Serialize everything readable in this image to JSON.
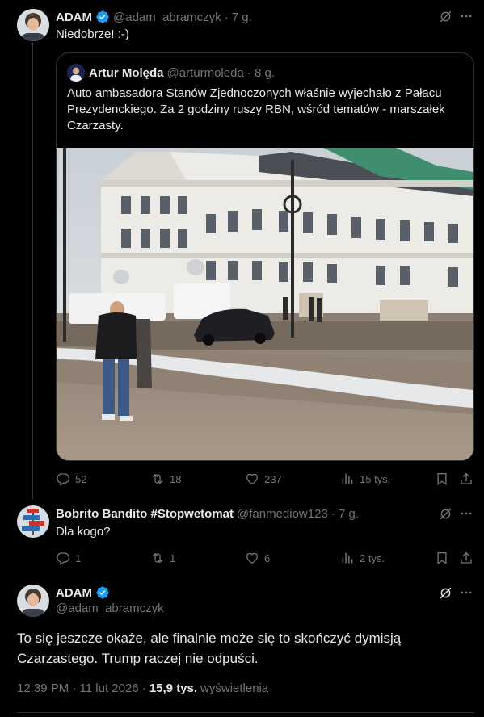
{
  "tweet1": {
    "name": "ADAM",
    "handle": "@adam_abramczyk",
    "time": "· 7 g.",
    "text": "Niedobrze! :-)",
    "quote": {
      "name": "Artur Molęda",
      "handle": "@arturmoleda",
      "time": "· 8 g.",
      "text": "Auto ambasadora Stanów Zjednoczonych właśnie wyjechało z Pałacu Prezydenckiego. Za 2 godziny ruszy RBN, wśród tematów - marszałek Czarzasty."
    },
    "stats": {
      "replies": "52",
      "reposts": "18",
      "likes": "237",
      "views": "15 tys."
    }
  },
  "tweet2": {
    "name": "Bobrito Bandito #Stopwetomat",
    "handle": "@fanmediow123",
    "time": "· 7 g.",
    "text": "Dla kogo?",
    "stats": {
      "replies": "1",
      "reposts": "1",
      "likes": "6",
      "views": "2 tys."
    }
  },
  "main": {
    "name": "ADAM",
    "handle": "@adam_abramczyk",
    "text": "To się jeszcze okaże, ale finalnie może się to skończyć dymisją Czarzastego. Trump raczej nie odpuści.",
    "timestamp": "12:39 PM · 11 lut 2026 ·",
    "views_count": "15,9 tys.",
    "views_label": "wyświetlenia"
  },
  "colors": {
    "verified": "#1d9bf0",
    "background": "#000000",
    "muted": "#71767b",
    "border": "#2f3336"
  },
  "icons": [
    "verified-icon",
    "grok-icon",
    "more-icon",
    "reply-icon",
    "repost-icon",
    "like-icon",
    "views-icon",
    "bookmark-icon",
    "share-icon"
  ]
}
